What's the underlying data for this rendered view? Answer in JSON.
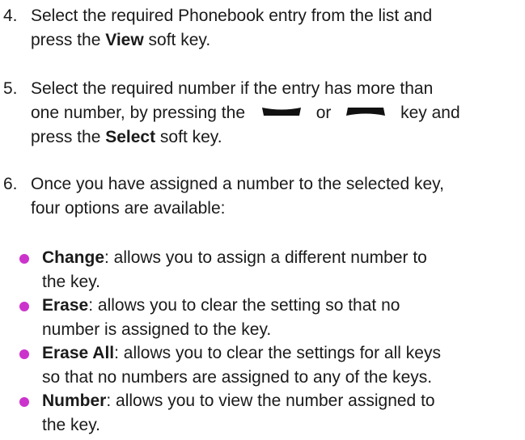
{
  "steps": [
    {
      "number": "4.",
      "line1": "Select the required Phonebook entry from the list and",
      "line2_pre": "press the ",
      "line2_bold": "View",
      "line2_post": " soft key."
    },
    {
      "number": "5.",
      "line1": "Select the required number if the entry has more than",
      "line2_pre": "one number, by pressing the",
      "line2_or": "or",
      "line2_post": "key and",
      "line3_pre": "press the ",
      "line3_bold": "Select",
      "line3_post": " soft key.",
      "icons": [
        "down-key-icon",
        "up-key-icon"
      ]
    },
    {
      "number": "6.",
      "line1": "Once you have assigned a number to the selected key,",
      "line2": "four options are available:"
    }
  ],
  "options": [
    {
      "term": "Change",
      "line1_rest": ": allows you to assign a different number to",
      "line2": "the key."
    },
    {
      "term": "Erase",
      "line1_rest": ": allows you to clear the setting so that no",
      "line2": "number is assigned to the key."
    },
    {
      "term": "Erase All",
      "line1_rest": ": allows you to clear the settings for all keys",
      "line2": "so that no numbers are assigned to any of the keys."
    },
    {
      "term": "Number",
      "line1_rest": ": allows you to view the number assigned to",
      "line2": "the key."
    }
  ],
  "colors": {
    "bullet": "#cc33cc",
    "text": "#1a1a1a"
  }
}
